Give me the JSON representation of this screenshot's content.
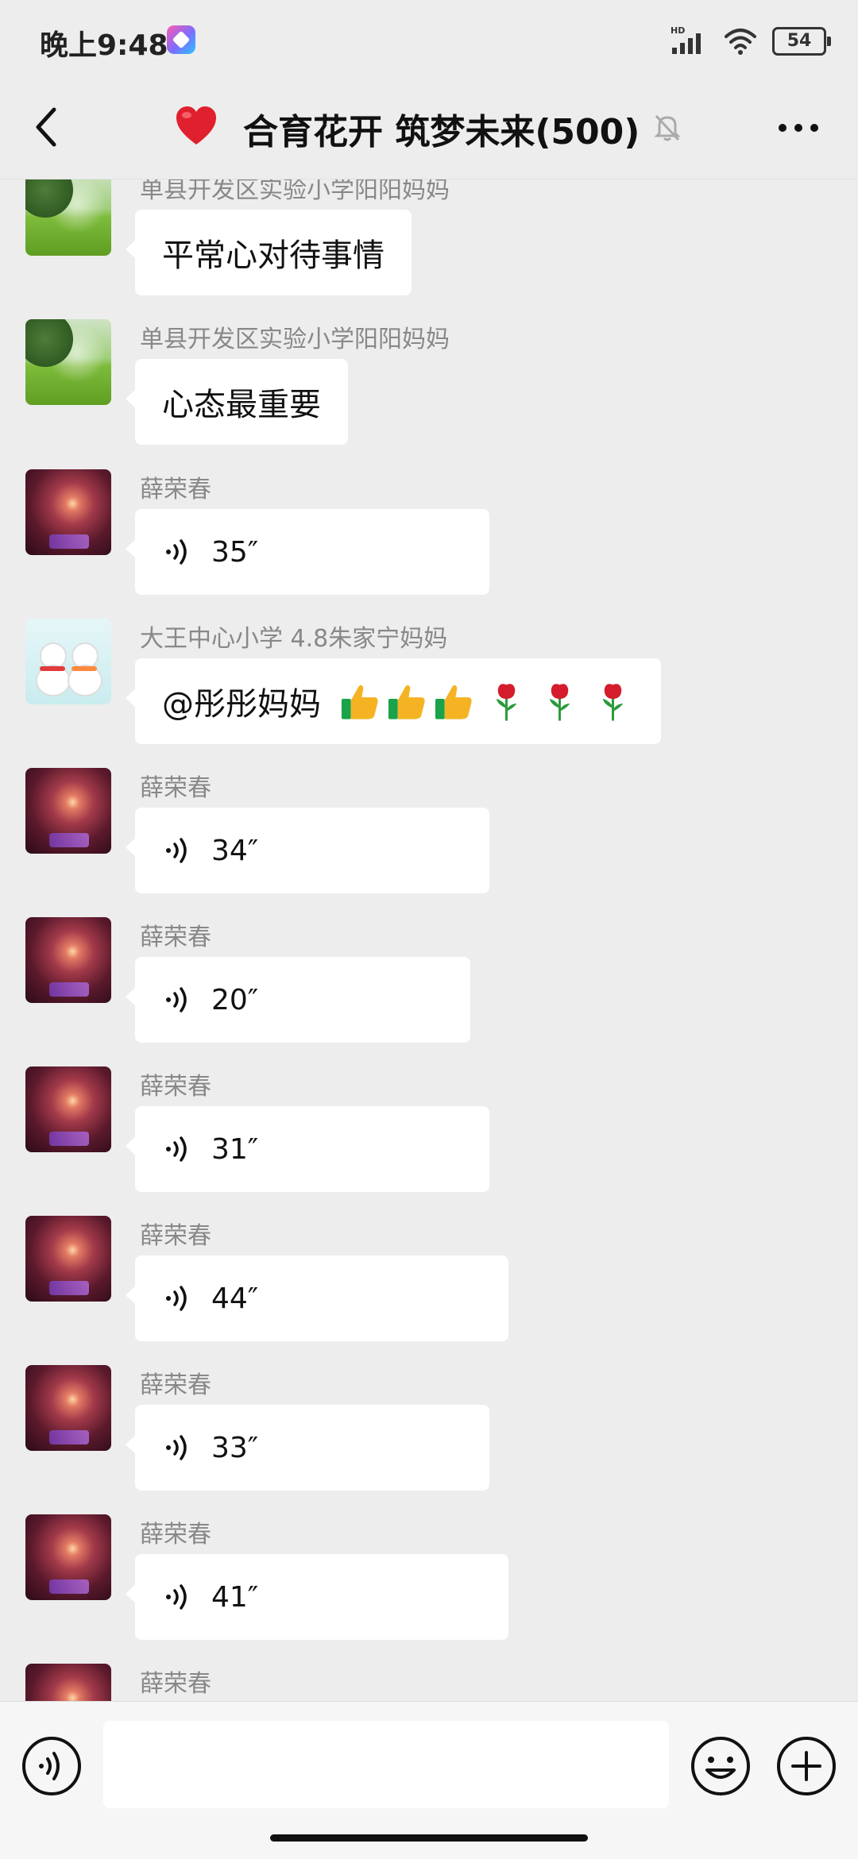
{
  "status_bar": {
    "time": "晚上9:48",
    "network": "HD",
    "battery": "54",
    "icons": [
      "app-icon",
      "signal-icon",
      "wifi-icon",
      "battery-icon"
    ]
  },
  "header": {
    "title": "合育花开 筑梦未来(500)",
    "icons": [
      "back-icon",
      "heart-icon",
      "mute-icon",
      "more-icon"
    ]
  },
  "messages": [
    {
      "sender": "单县开发区实验小学阳阳妈妈",
      "type": "text",
      "text": "平常心对待事情",
      "avatar": "landscape"
    },
    {
      "sender": "单县开发区实验小学阳阳妈妈",
      "type": "text",
      "text": "心态最重要",
      "avatar": "landscape"
    },
    {
      "sender": "薛荣春",
      "type": "voice",
      "duration": "35″",
      "avatar": "firework"
    },
    {
      "sender": "大王中心小学 4.8朱家宁妈妈",
      "type": "text",
      "text": "@彤彤妈妈",
      "emojis": [
        "thumbs-up",
        "thumbs-up",
        "thumbs-up",
        "rose",
        "rose",
        "rose"
      ],
      "avatar": "snowman"
    },
    {
      "sender": "薛荣春",
      "type": "voice",
      "duration": "34″",
      "avatar": "firework"
    },
    {
      "sender": "薛荣春",
      "type": "voice",
      "duration": "20″",
      "avatar": "firework"
    },
    {
      "sender": "薛荣春",
      "type": "voice",
      "duration": "31″",
      "avatar": "firework"
    },
    {
      "sender": "薛荣春",
      "type": "voice",
      "duration": "44″",
      "avatar": "firework"
    },
    {
      "sender": "薛荣春",
      "type": "voice",
      "duration": "33″",
      "avatar": "firework"
    },
    {
      "sender": "薛荣春",
      "type": "voice",
      "duration": "41″",
      "avatar": "firework"
    },
    {
      "sender": "薛荣春",
      "type": "voice",
      "avatar": "firework"
    }
  ],
  "input_bar": {
    "placeholder": "",
    "icons": [
      "voice-mode-icon",
      "emoji-icon",
      "plus-icon"
    ]
  },
  "colors": {
    "background": "#ededed",
    "bubble": "#ffffff",
    "sender_text": "#888888",
    "input_bar": "#f6f6f6"
  }
}
